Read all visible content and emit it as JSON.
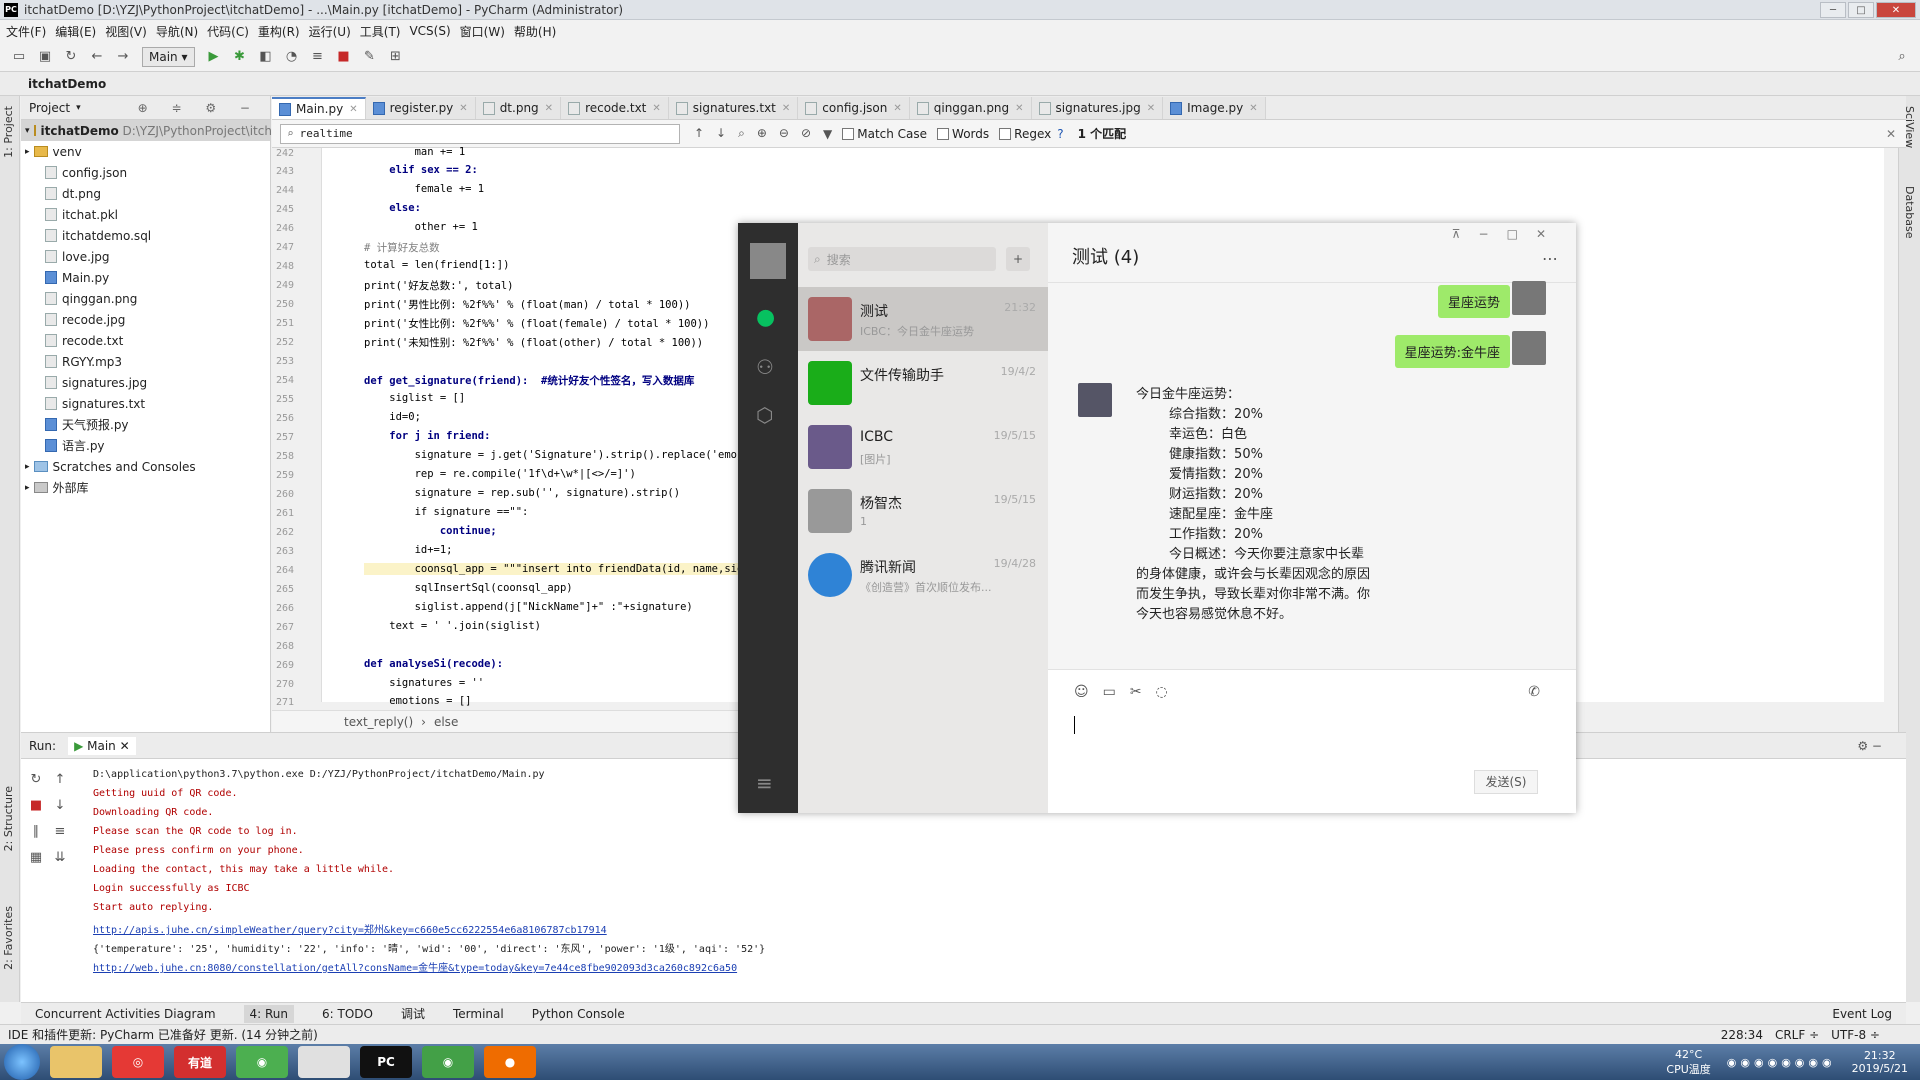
{
  "title": "itchatDemo [D:\\YZJ\\PythonProject\\itchatDemo] - ...\\Main.py [itchatDemo] - PyCharm (Administrator)",
  "menu": [
    "文件(F)",
    "编辑(E)",
    "视图(V)",
    "导航(N)",
    "代码(C)",
    "重构(R)",
    "运行(U)",
    "工具(T)",
    "VCS(S)",
    "窗口(W)",
    "帮助(H)"
  ],
  "run_config": "Main",
  "nav": "itchatDemo",
  "left_tabs": {
    "project": "1: Project",
    "structure": "2: Structure",
    "favorites": "2: Favorites"
  },
  "right_tabs": {
    "sciview": "SciView",
    "database": "Database"
  },
  "project": {
    "header": "Project",
    "root": "itchatDemo",
    "root_path": "D:\\YZJ\\PythonProject\\itcha",
    "items": [
      "venv",
      "config.json",
      "dt.png",
      "itchat.pkl",
      "itchatdemo.sql",
      "love.jpg",
      "Main.py",
      "qinggan.png",
      "recode.jpg",
      "recode.txt",
      "RGYY.mp3",
      "signatures.jpg",
      "signatures.txt",
      "天气预报.py",
      "语言.py",
      "Scratches and Consoles",
      "外部库"
    ]
  },
  "tabs": [
    "Main.py",
    "register.py",
    "dt.png",
    "recode.txt",
    "signatures.txt",
    "config.json",
    "qinggan.png",
    "signatures.jpg",
    "Image.py"
  ],
  "find": {
    "query": "realtime",
    "match_case": "Match Case",
    "words": "Words",
    "regex": "Regex",
    "result": "1 个匹配"
  },
  "code": {
    "lines": [
      {
        "n": "242",
        "t": "        man += 1"
      },
      {
        "n": "243",
        "t": "    elif sex == 2:"
      },
      {
        "n": "244",
        "t": "        female += 1"
      },
      {
        "n": "245",
        "t": "    else:"
      },
      {
        "n": "246",
        "t": "        other += 1"
      },
      {
        "n": "247",
        "t": "# 计算好友总数"
      },
      {
        "n": "248",
        "t": "total = len(friend[1:])"
      },
      {
        "n": "249",
        "t": "print('好友总数:', total)"
      },
      {
        "n": "250",
        "t": "print('男性比例: %2f%%' % (float(man) / total * 100))"
      },
      {
        "n": "251",
        "t": "print('女性比例: %2f%%' % (float(female) / total * 100))"
      },
      {
        "n": "252",
        "t": "print('未知性别: %2f%%' % (float(other) / total * 100))"
      },
      {
        "n": "253",
        "t": ""
      },
      {
        "n": "254",
        "t": "def get_signature(friend):  #统计好友个性签名，写入数据库"
      },
      {
        "n": "255",
        "t": "    siglist = []"
      },
      {
        "n": "256",
        "t": "    id=0;"
      },
      {
        "n": "257",
        "t": "    for j in friend:"
      },
      {
        "n": "258",
        "t": "        signature = j.get('Signature').strip().replace('emoji',"
      },
      {
        "n": "259",
        "t": "        rep = re.compile('1f\\d+\\w*|[<>/=]')"
      },
      {
        "n": "260",
        "t": "        signature = rep.sub('', signature).strip()"
      },
      {
        "n": "261",
        "t": "        if signature ==\"\":"
      },
      {
        "n": "262",
        "t": "            continue;"
      },
      {
        "n": "263",
        "t": "        id+=1;"
      },
      {
        "n": "264",
        "t": "        coonsql_app = \"\"\"insert into friendData(id, name,signat"
      },
      {
        "n": "265",
        "t": "        sqlInsertSql(coonsql_app)"
      },
      {
        "n": "266",
        "t": "        siglist.append(j[\"NickName\"]+\" :\"+signature)"
      },
      {
        "n": "267",
        "t": "    text = ' '.join(siglist)"
      },
      {
        "n": "268",
        "t": ""
      },
      {
        "n": "269",
        "t": "def analyseSi(recode):"
      },
      {
        "n": "270",
        "t": "    signatures = ''"
      },
      {
        "n": "271",
        "t": "    emotions = []"
      }
    ]
  },
  "breadcrumb": {
    "a": "text_reply()",
    "b": "else"
  },
  "run": {
    "label": "Run:",
    "config": "Main",
    "lines": [
      "D:\\application\\python3.7\\python.exe D:/YZJ/PythonProject/itchatDemo/Main.py",
      "Getting uuid of QR code.",
      "Downloading QR code.",
      "Please scan the QR code to log in.",
      "Please press confirm on your phone.",
      "Loading the contact, this may take a little while.",
      "Login successfully as ICBC",
      "Start auto replying.",
      "http://apis.juhe.cn/simpleWeather/query?city=郑州&key=c660e5cc6222554e6a8106787cb17914",
      "{'temperature': '25', 'humidity': '22', 'info': '晴', 'wid': '00', 'direct': '东风', 'power': '1级', 'aqi': '52'}",
      "http://web.juhe.cn:8080/constellation/getAll?consName=金牛座&type=today&key=7e44ce8fbe902093d3ca260c892c6a50"
    ]
  },
  "bottom_tabs": [
    "Concurrent Activities Diagram",
    "4: Run",
    "6: TODO",
    "调试",
    "Terminal",
    "Python Console",
    "Event Log"
  ],
  "status": {
    "msg": "IDE 和插件更新: PyCharm 已准备好 更新. (14 分钟之前)",
    "pos": "228:34",
    "crlf": "CRLF ÷",
    "enc": "UTF-8 ÷"
  },
  "taskbar": {
    "temp": "42°C",
    "cpu": "CPU温度",
    "time": "21:32",
    "date": "2019/5/21"
  },
  "wechat": {
    "search": "搜索",
    "chat_title": "测试 (4)",
    "contacts": [
      {
        "name": "测试",
        "preview": "ICBC：今日金牛座运势",
        "date": "21:32"
      },
      {
        "name": "文件传输助手",
        "preview": "",
        "date": "19/4/2"
      },
      {
        "name": "ICBC",
        "preview": "[图片]",
        "date": "19/5/15"
      },
      {
        "name": "杨智杰",
        "preview": "1",
        "date": "19/5/15"
      },
      {
        "name": "腾讯新闻",
        "preview": "《创造营》首次顺位发布...",
        "date": "19/4/28"
      }
    ],
    "bubbles": [
      "星座运势",
      "星座运势:金牛座"
    ],
    "message": "今日金牛座运势：\n        综合指数：20%\n        幸运色：白色\n        健康指数：50%\n        爱情指数：20%\n        财运指数：20%\n        速配星座：金牛座\n        工作指数：20%\n        今日概述：今天你要注意家中长辈\n的身体健康，或许会与长辈因观念的原因\n而发生争执，导致长辈对你非常不满。你\n今天也容易感觉休息不好。",
    "send": "发送(S)"
  }
}
